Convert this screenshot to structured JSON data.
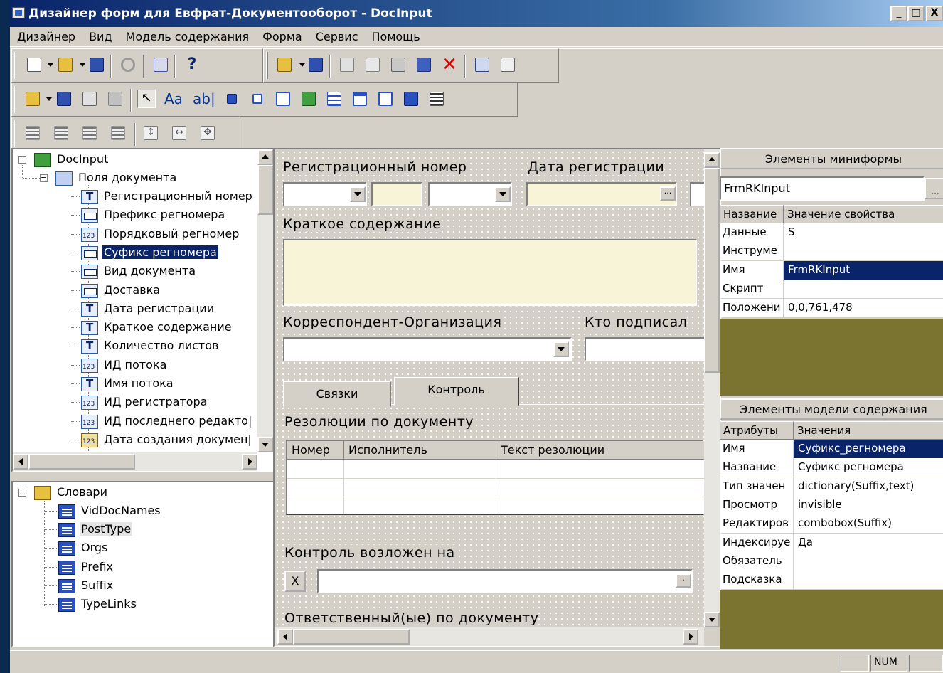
{
  "window": {
    "title": "Дизайнер форм для Евфрат-Документооборот - DocInput",
    "buttons": [
      "_",
      "□",
      "X"
    ]
  },
  "menu": [
    "Дизайнер",
    "Вид",
    "Модель содержания",
    "Форма",
    "Сервис",
    "Помощь"
  ],
  "toolbar_text": {
    "label_tool": "Aa",
    "edit_tool": "ab|"
  },
  "fields_tree": {
    "root": "DocInput",
    "group": "Поля документа",
    "items": [
      {
        "icon": "text",
        "label": "Регистрационный номер"
      },
      {
        "icon": "box",
        "label": "Префикс регномера"
      },
      {
        "icon": "number",
        "label": "Порядковый регномер"
      },
      {
        "icon": "box",
        "label": "Суфикс регномера"
      },
      {
        "icon": "box",
        "label": "Вид документа"
      },
      {
        "icon": "box",
        "label": "Доставка"
      },
      {
        "icon": "text",
        "label": "Дата регистрации"
      },
      {
        "icon": "text",
        "label": "Краткое содержание"
      },
      {
        "icon": "text",
        "label": "Количество листов"
      },
      {
        "icon": "number",
        "label": "ИД потока"
      },
      {
        "icon": "text",
        "label": "Имя потока"
      },
      {
        "icon": "number",
        "label": "ИД регистратора"
      },
      {
        "icon": "number",
        "label": "ИД последнего редакто|"
      },
      {
        "icon": "date",
        "label": "Дата создания докумен|"
      }
    ],
    "selected_index": 3
  },
  "dict_tree": {
    "root": "Словари",
    "items": [
      "VidDocNames",
      "PostType",
      "Orgs",
      "Prefix",
      "Suffix",
      "TypeLinks"
    ],
    "highlighted_index": 1
  },
  "form": {
    "reg_number_label": "Регистрационный номер",
    "reg_date_label": "Дата регистрации",
    "summary_label": "Краткое содержание",
    "correspondent_label": "Корреспондент-Организация",
    "signed_by_label": "Кто подписал",
    "tabs": [
      "Связки",
      "Контроль"
    ],
    "active_tab": 1,
    "resolutions_label": "Резолюции по документу",
    "grid_columns": [
      "Номер",
      "Исполнитель",
      "Текст резолюции"
    ],
    "control_label": "Контроль возложен на",
    "clear_button": "X",
    "responsible_label": "Ответственный(ые) по документу",
    "ellipsis": "..."
  },
  "miniform": {
    "title": "Элементы миниформы",
    "combo_value": "FrmRKInput",
    "combo_button": "...",
    "col_name": "Название",
    "col_value": "Значение свойства",
    "rows": [
      {
        "key": "Данные",
        "value": "S"
      },
      {
        "key": "Инструме",
        "value": ""
      },
      {
        "key": "Имя",
        "value": "FrmRKInput"
      },
      {
        "key": "Скрипт",
        "value": ""
      },
      {
        "key": "Положени",
        "value": "0,0,761,478"
      }
    ],
    "selected_row": 2
  },
  "content_model": {
    "title": "Элементы модели содержания",
    "col_attr": "Атрибуты",
    "col_value": "Значения",
    "rows": [
      {
        "key": "Имя",
        "value": "Суфикс_регномера"
      },
      {
        "key": "Название",
        "value": "Суфикс регномера"
      },
      {
        "key": "Тип значен",
        "value": "dictionary(Suffix,text)"
      },
      {
        "key": "Просмотр",
        "value": "invisible"
      },
      {
        "key": "Редактиров",
        "value": "combobox(Suffix)"
      },
      {
        "key": "Индексируе",
        "value": "Да"
      },
      {
        "key": "Обязатель",
        "value": ""
      },
      {
        "key": "Подсказка",
        "value": ""
      }
    ],
    "selected_row": 0
  },
  "status": {
    "num": "NUM"
  },
  "colors": {
    "selection": "#0a246a",
    "olive_panel": "#7a7430",
    "input_yellow": "#f8f4d8",
    "chrome": "#d4d0c8"
  }
}
